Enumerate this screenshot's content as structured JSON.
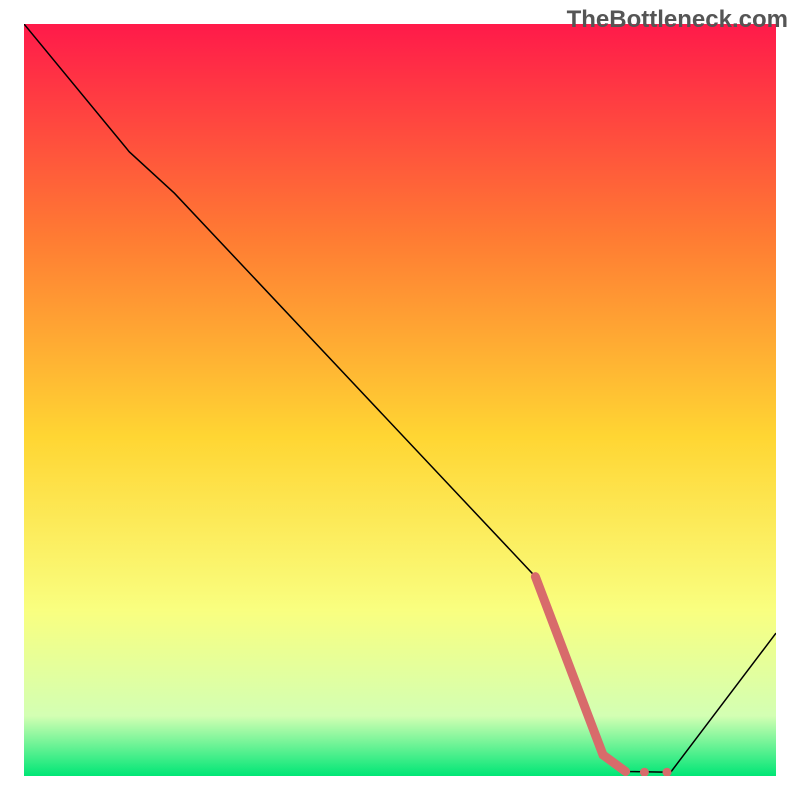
{
  "watermark": "TheBottleneck.com",
  "chart_data": {
    "type": "line",
    "title": "",
    "xlabel": "",
    "ylabel": "",
    "xlim": [
      0,
      100
    ],
    "ylim": [
      0,
      100
    ],
    "background_gradient": {
      "top": "#ff1a4a",
      "mid_upper": "#ff7a33",
      "mid": "#ffd633",
      "mid_lower": "#f9ff80",
      "lower": "#d3ffb3",
      "bottom": "#00e676"
    },
    "series": [
      {
        "name": "curve",
        "color": "#000000",
        "thickness": 1.5,
        "points": [
          {
            "x": 0,
            "y": 100
          },
          {
            "x": 14,
            "y": 83
          },
          {
            "x": 20,
            "y": 77.5
          },
          {
            "x": 68,
            "y": 26.5
          },
          {
            "x": 77,
            "y": 2.8
          },
          {
            "x": 80,
            "y": 0.6
          },
          {
            "x": 86,
            "y": 0.5
          },
          {
            "x": 100,
            "y": 19
          }
        ]
      },
      {
        "name": "highlight",
        "color": "#d86b6b",
        "thickness": 9,
        "points": [
          {
            "x": 68,
            "y": 26.5
          },
          {
            "x": 77,
            "y": 2.8
          },
          {
            "x": 80,
            "y": 0.6
          }
        ],
        "dots": [
          {
            "x": 82.5,
            "y": 0.5
          },
          {
            "x": 85.5,
            "y": 0.5
          }
        ]
      }
    ]
  }
}
